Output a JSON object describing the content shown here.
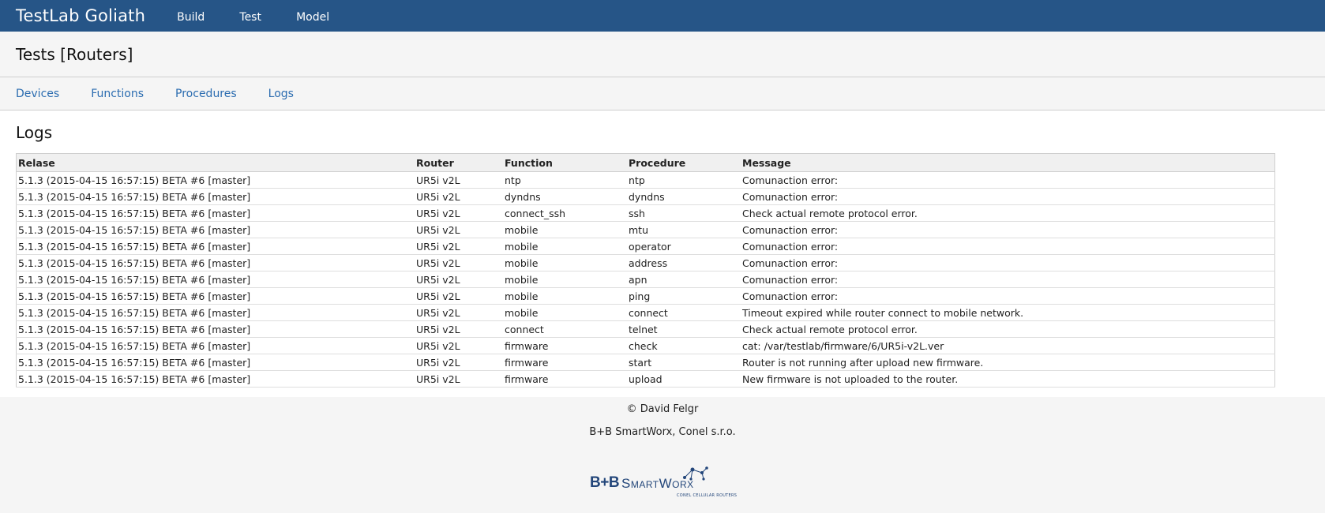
{
  "header": {
    "brand": "TestLab Goliath",
    "nav": [
      "Build",
      "Test",
      "Model"
    ]
  },
  "page_title": "Tests [Routers]",
  "subnav": [
    "Devices",
    "Functions",
    "Procedures",
    "Logs"
  ],
  "section_title": "Logs",
  "table": {
    "columns": [
      "Relase",
      "Router",
      "Function",
      "Procedure",
      "Message"
    ],
    "rows": [
      [
        "5.1.3 (2015-04-15 16:57:15) BETA #6 [master]",
        "UR5i v2L",
        "ntp",
        "ntp",
        "Comunaction error:"
      ],
      [
        "5.1.3 (2015-04-15 16:57:15) BETA #6 [master]",
        "UR5i v2L",
        "dyndns",
        "dyndns",
        "Comunaction error:"
      ],
      [
        "5.1.3 (2015-04-15 16:57:15) BETA #6 [master]",
        "UR5i v2L",
        "connect_ssh",
        "ssh",
        "Check actual remote protocol error."
      ],
      [
        "5.1.3 (2015-04-15 16:57:15) BETA #6 [master]",
        "UR5i v2L",
        "mobile",
        "mtu",
        "Comunaction error:"
      ],
      [
        "5.1.3 (2015-04-15 16:57:15) BETA #6 [master]",
        "UR5i v2L",
        "mobile",
        "operator",
        "Comunaction error:"
      ],
      [
        "5.1.3 (2015-04-15 16:57:15) BETA #6 [master]",
        "UR5i v2L",
        "mobile",
        "address",
        "Comunaction error:"
      ],
      [
        "5.1.3 (2015-04-15 16:57:15) BETA #6 [master]",
        "UR5i v2L",
        "mobile",
        "apn",
        "Comunaction error:"
      ],
      [
        "5.1.3 (2015-04-15 16:57:15) BETA #6 [master]",
        "UR5i v2L",
        "mobile",
        "ping",
        "Comunaction error:"
      ],
      [
        "5.1.3 (2015-04-15 16:57:15) BETA #6 [master]",
        "UR5i v2L",
        "mobile",
        "connect",
        "Timeout expired while router connect to mobile network."
      ],
      [
        "5.1.3 (2015-04-15 16:57:15) BETA #6 [master]",
        "UR5i v2L",
        "connect",
        "telnet",
        "Check actual remote protocol error."
      ],
      [
        "5.1.3 (2015-04-15 16:57:15) BETA #6 [master]",
        "UR5i v2L",
        "firmware",
        "check",
        "cat: /var/testlab/firmware/6/UR5i-v2L.ver"
      ],
      [
        "5.1.3 (2015-04-15 16:57:15) BETA #6 [master]",
        "UR5i v2L",
        "firmware",
        "start",
        "Router is not running after upload new firmware."
      ],
      [
        "5.1.3 (2015-04-15 16:57:15) BETA #6 [master]",
        "UR5i v2L",
        "firmware",
        "upload",
        "New firmware is not uploaded to the router."
      ]
    ]
  },
  "footer": {
    "copyright": "© David Felgr",
    "company": "B+B SmartWorx, Conel s.r.o.",
    "logo": {
      "text_bb": "B+B",
      "text_smartworx": "SmartWorx",
      "tagline": "CONEL CELLULAR ROUTERS",
      "icon": "network-logo-icon"
    }
  },
  "colors": {
    "topbar": "#265587",
    "link": "#2b6cb0",
    "background": "#f5f5f5"
  }
}
